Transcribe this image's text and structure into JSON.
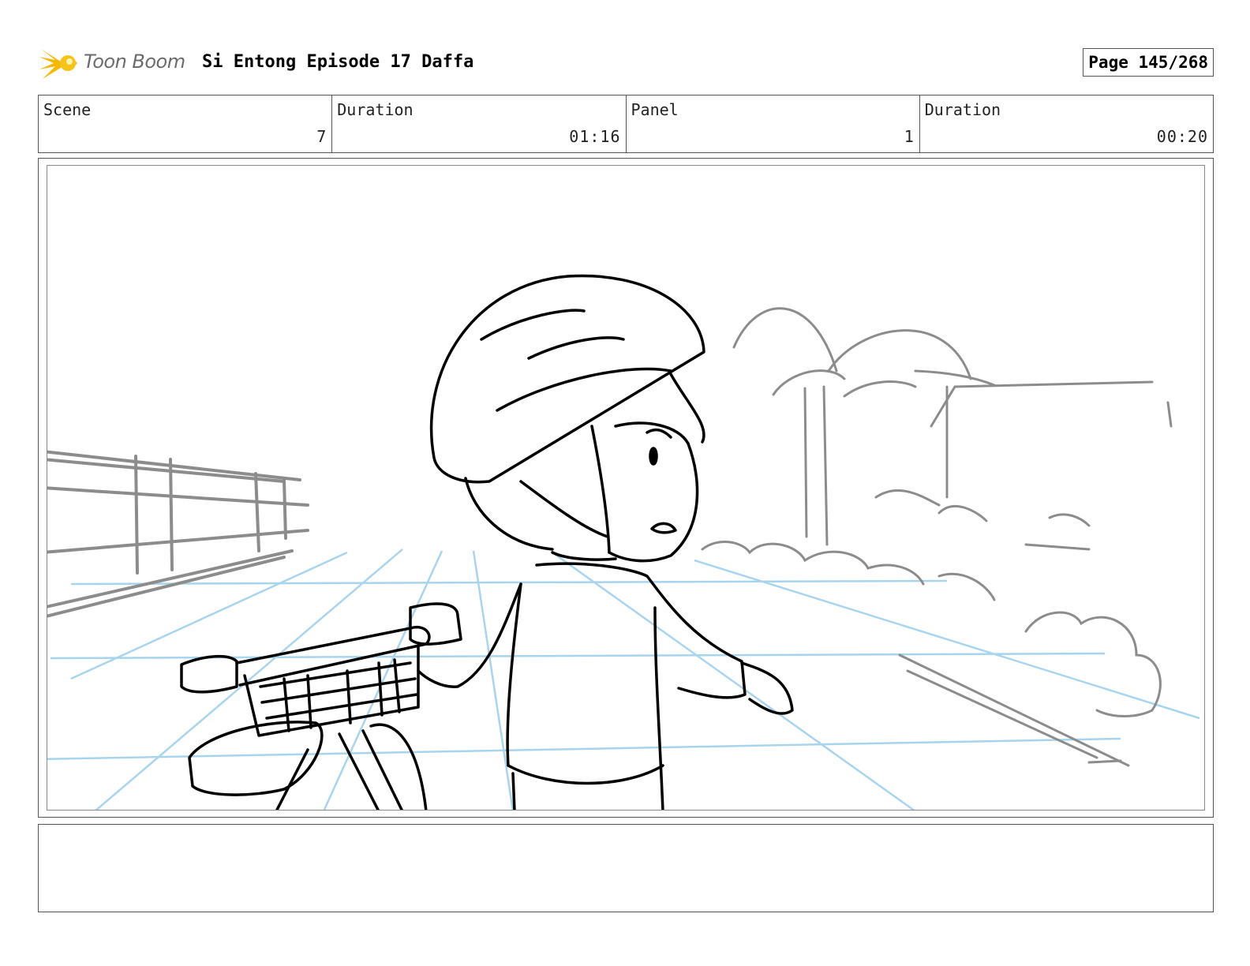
{
  "header": {
    "logo_text": "Toon Boom",
    "project_title": "Si Entong Episode 17 Daffa",
    "page_label": "Page 145/268"
  },
  "info": {
    "scene_label": "Scene",
    "scene_value": "7",
    "scene_duration_label": "Duration",
    "scene_duration_value": "01:16",
    "panel_label": "Panel",
    "panel_value": "1",
    "panel_duration_label": "Duration",
    "panel_duration_value": "00:20"
  },
  "notes": {
    "text": ""
  },
  "colors": {
    "perspective_guides": "#a9d4ee",
    "background_sketch": "#8c8c8c",
    "foreground_ink": "#000000",
    "logo_star": "#f5b800"
  }
}
